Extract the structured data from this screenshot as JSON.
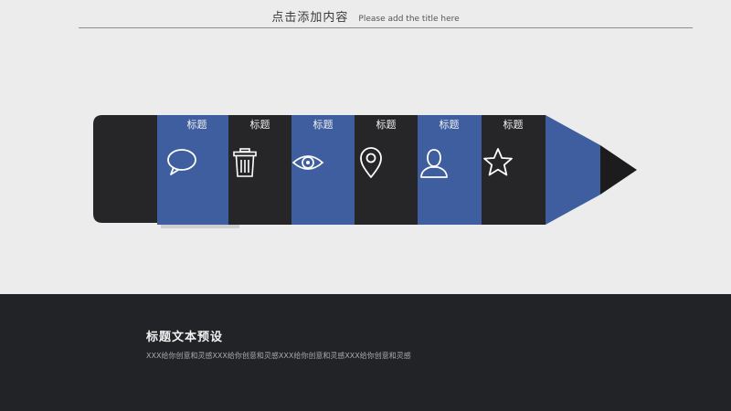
{
  "header": {
    "title_cn": "点击添加内容",
    "title_en": "Please add the title here"
  },
  "pencil": {
    "colors": {
      "dark": "#262628",
      "blue": "#3e5e9f",
      "tip": "#1c1c1e",
      "icon": "#ffffff"
    },
    "segments": [
      {
        "icon": "speech-bubble-icon",
        "label": "标题"
      },
      {
        "icon": "trash-icon",
        "label": "标题"
      },
      {
        "icon": "eye-icon",
        "label": "标题"
      },
      {
        "icon": "location-pin-icon",
        "label": "标题"
      },
      {
        "icon": "user-icon",
        "label": "标题"
      },
      {
        "icon": "star-icon",
        "label": "标题"
      }
    ]
  },
  "footer": {
    "title": "标题文本预设",
    "desc": "XXX给你创意和灵感XXX给你创意和灵感XXX给你创意和灵感XXX给你创意和灵感"
  }
}
